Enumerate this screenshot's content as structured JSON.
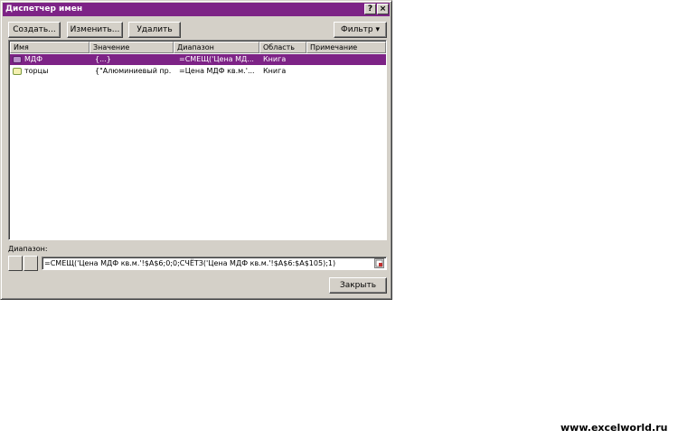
{
  "window": {
    "title": "Диспетчер имен",
    "help_glyph": "?",
    "close_glyph": "×"
  },
  "toolbar": {
    "create_label": "Создать...",
    "edit_label": "Изменить...",
    "delete_label": "Удалить",
    "filter_label": "Фильтр",
    "filter_arrow": "▾"
  },
  "table": {
    "columns": [
      "Имя",
      "Значение",
      "Диапазон",
      "Область",
      "Примечание"
    ],
    "rows": [
      {
        "name": "МДФ",
        "value": "{...}",
        "range": "=СМЕЩ('Цена МД...",
        "scope": "Книга",
        "note": ""
      },
      {
        "name": "торцы",
        "value": "{\"Алюминиевый пр...",
        "range": "=Цена МДФ кв.м.'...",
        "scope": "Книга",
        "note": ""
      }
    ]
  },
  "range_section": {
    "label": "Диапазон:",
    "formula": "=СМЕЩ('Цена МДФ кв.м.'!$A$6;0;0;СЧЁТЗ('Цена МДФ кв.м.'!$A$6:$A$105);1)"
  },
  "footer": {
    "close_label": "Закрыть"
  },
  "watermark": "www.excelworld.ru",
  "colors": {
    "title_bar": "#7d2386",
    "selection": "#7d2386",
    "dialog_face": "#d4d0c8"
  }
}
